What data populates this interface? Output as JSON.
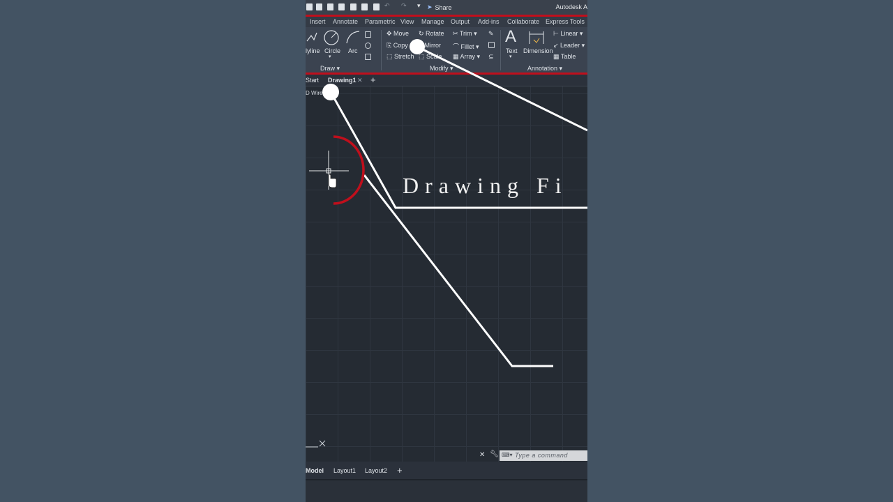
{
  "qat": {
    "share_label": "Share",
    "app_title": "Autodesk A"
  },
  "ribbon_tabs": [
    "Insert",
    "Annotate",
    "Parametric",
    "View",
    "Manage",
    "Output",
    "Add-ins",
    "Collaborate",
    "Express Tools"
  ],
  "draw": {
    "polyline": "lyline",
    "circle": "Circle",
    "arc": "Arc",
    "panel": "Draw"
  },
  "modify": {
    "move": "Move",
    "rotate": "Rotate",
    "trim": "Trim",
    "copy": "Copy",
    "mirror": "Mirror",
    "fillet": "Fillet",
    "stretch": "Stretch",
    "scale": "Scale",
    "array": "Array",
    "panel": "Modify"
  },
  "annotation": {
    "text": "Text",
    "dimension": "Dimension",
    "linear": "Linear",
    "leader": "Leader",
    "table": "Table",
    "panel": "Annotation"
  },
  "doc_tabs": {
    "start": "Start",
    "drawing": "Drawing1"
  },
  "viewport": {
    "view_label": "D Wire",
    "overlay_title": "Drawing Fi"
  },
  "command": {
    "placeholder": "Type a command"
  },
  "layout_tabs": [
    "Model",
    "Layout1",
    "Layout2"
  ],
  "colors": {
    "accent_red": "#c00f1c",
    "canvas": "#252b33",
    "ribbon": "#3b4350"
  }
}
